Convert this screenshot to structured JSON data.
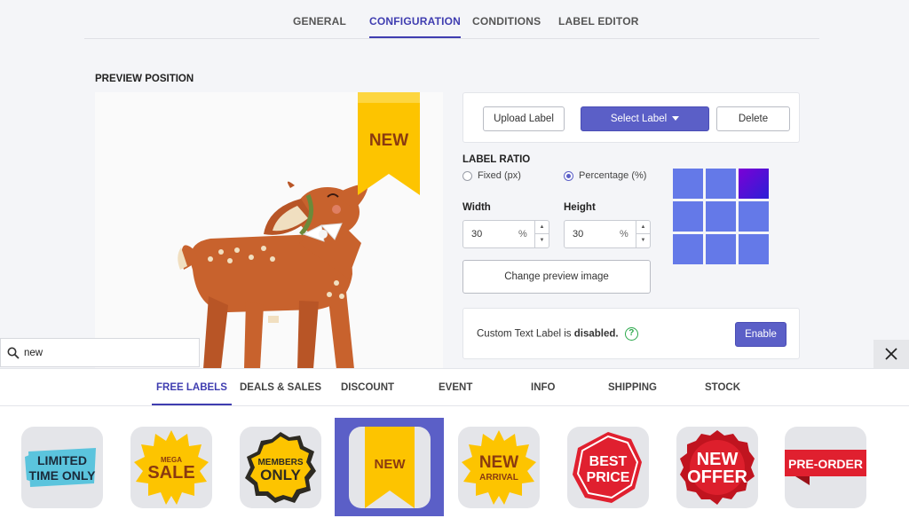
{
  "top_tabs": [
    "GENERAL",
    "CONFIGURATION",
    "CONDITIONS",
    "LABEL EDITOR"
  ],
  "active_tab": "CONFIGURATION",
  "section_title": "PREVIEW POSITION",
  "preview": {
    "ribbon_text": "NEW"
  },
  "actions": {
    "upload": "Upload Label",
    "select": "Select Label",
    "delete": "Delete"
  },
  "label_ratio": {
    "title": "LABEL RATIO",
    "fixed": "Fixed (px)",
    "percentage": "Percentage (%)",
    "selected": "percentage"
  },
  "width": {
    "label": "Width",
    "value": "30",
    "unit": "%"
  },
  "height": {
    "label": "Height",
    "value": "30",
    "unit": "%"
  },
  "position_grid": {
    "selected_cell": "top-right",
    "color": "#6479e8"
  },
  "change_preview": "Change preview image",
  "custom_text": {
    "prefix": "Custom Text Label is",
    "status": "disabled.",
    "help": "?",
    "button": "Enable"
  },
  "search": {
    "value": "new",
    "placeholder": ""
  },
  "categories": [
    "FREE LABELS",
    "DEALS & SALES",
    "DISCOUNT",
    "EVENT",
    "INFO",
    "SHIPPING",
    "STOCK"
  ],
  "active_category": "FREE LABELS",
  "labels": [
    {
      "line1": "LIMITED",
      "line2": "TIME ONLY"
    },
    {
      "line1": "MEGA",
      "line2": "SALE"
    },
    {
      "line1": "MEMBERS",
      "line2": "ONLY"
    },
    {
      "line1": "NEW",
      "line2": ""
    },
    {
      "line1": "NEW",
      "line2": "ARRIVAL"
    },
    {
      "line1": "BEST",
      "line2": "PRICE"
    },
    {
      "line1": "NEW",
      "line2": "OFFER"
    },
    {
      "line1": "PRE-ORDER",
      "line2": ""
    }
  ],
  "selected_label_index": 3
}
